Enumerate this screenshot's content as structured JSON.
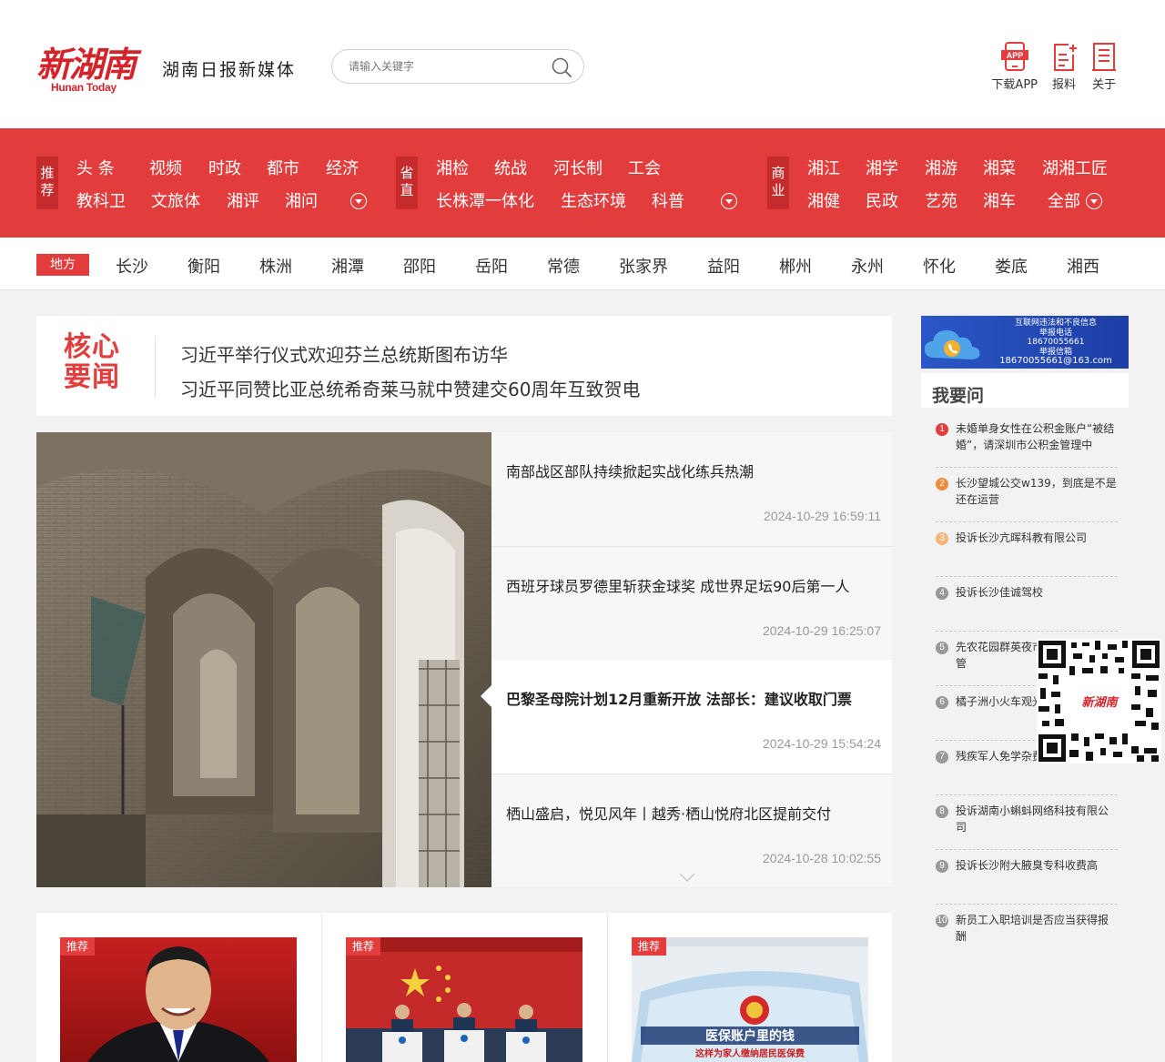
{
  "header": {
    "logo_text": "新湖南",
    "logo_subtext": "Hunan Today",
    "tagline": "湖南日报新媒体",
    "search_placeholder": "请输入关键字",
    "actions": [
      {
        "label": "下载APP",
        "icon": "app-download-icon",
        "icon_text": "APP"
      },
      {
        "label": "报料",
        "icon": "report-icon"
      },
      {
        "label": "关于",
        "icon": "about-icon"
      }
    ]
  },
  "nav": {
    "groups": [
      {
        "tag": "推荐",
        "row1": [
          "头 条",
          "视频",
          "时政",
          "都市",
          "经济"
        ],
        "row2": [
          "教科卫",
          "文旅体",
          "湘评",
          "湘问"
        ]
      },
      {
        "tag": "省直",
        "row1": [
          "湘检",
          "统战",
          "河长制",
          "工会"
        ],
        "row2": [
          "长株潭一体化",
          "生态环境",
          "科普"
        ]
      },
      {
        "tag": "商业",
        "row1": [
          "湘江",
          "湘学",
          "湘游",
          "湘菜",
          "湖湘工匠"
        ],
        "row2": [
          "湘健",
          "民政",
          "艺苑",
          "湘车",
          "全部"
        ]
      }
    ]
  },
  "local": {
    "tag": "地方",
    "cities": [
      "长沙",
      "衡阳",
      "株洲",
      "湘潭",
      "邵阳",
      "岳阳",
      "常德",
      "张家界",
      "益阳",
      "郴州",
      "永州",
      "怀化",
      "娄底",
      "湘西"
    ]
  },
  "core_news": {
    "label_line1": "核心",
    "label_line2": "要闻",
    "items": [
      "习近平举行仪式欢迎芬兰总统斯图布访华",
      "习近平同赞比亚总统希奇莱马就中赞建交60周年互致贺电"
    ]
  },
  "slider": {
    "active_index": 2,
    "items": [
      {
        "title": "南部战区部队持续掀起实战化练兵热潮",
        "time": "2024-10-29 16:59:11"
      },
      {
        "title": "西班牙球员罗德里斩获金球奖 成世界足坛90后第一人",
        "time": "2024-10-29 16:25:07"
      },
      {
        "title": "巴黎圣母院计划12月重新开放 法部长：建议收取门票",
        "time": "2024-10-29 15:54:24"
      },
      {
        "title": "栖山盛启，悦见风年丨越秀·栖山悦府北区提前交付",
        "time": "2024-10-28 10:02:55"
      }
    ]
  },
  "cards": [
    {
      "badge": "推荐"
    },
    {
      "badge": "推荐"
    },
    {
      "badge": "推荐",
      "image_caption": "医保账户里的钱",
      "image_subcaption": "这样为家人缴纳居民医保费"
    }
  ],
  "sidebar": {
    "banner": {
      "line1": "互联网违法和不良信息",
      "line2": "举报电话",
      "phone": "18670055661",
      "line3": "举报信箱",
      "email": "18670055661@163.com"
    },
    "ask_title": "我要问",
    "ask_items": [
      {
        "num": "1",
        "text": "未婚单身女性在公积金账户“被结婚”，请深圳市公积金管理中"
      },
      {
        "num": "2",
        "text": "长沙望城公交w139，到底是不是还在运营"
      },
      {
        "num": "3",
        "text": "投诉长沙亢晖科教有限公司"
      },
      {
        "num": "4",
        "text": "投诉长沙佳诚驾校"
      },
      {
        "num": "5",
        "text": "先农花园群英夜市都预埋了道柱管"
      },
      {
        "num": "6",
        "text": "橘子洲小火车观光态度恶劣"
      },
      {
        "num": "7",
        "text": "残疾军人免学杂费"
      },
      {
        "num": "8",
        "text": "投诉湖南小蝌蚪网络科技有限公司"
      },
      {
        "num": "9",
        "text": "投诉长沙附大腋臭专科收费高"
      },
      {
        "num": "10",
        "text": "新员工入职培训是否应当获得报酬"
      }
    ],
    "qr_label": "新湖南"
  },
  "colors": {
    "brand_red": "#e23c3c",
    "tag_dark_red": "#c62b2b",
    "num_red": "#e23c3c",
    "num_orange": "#f08a3c",
    "num_gray": "#999999"
  }
}
